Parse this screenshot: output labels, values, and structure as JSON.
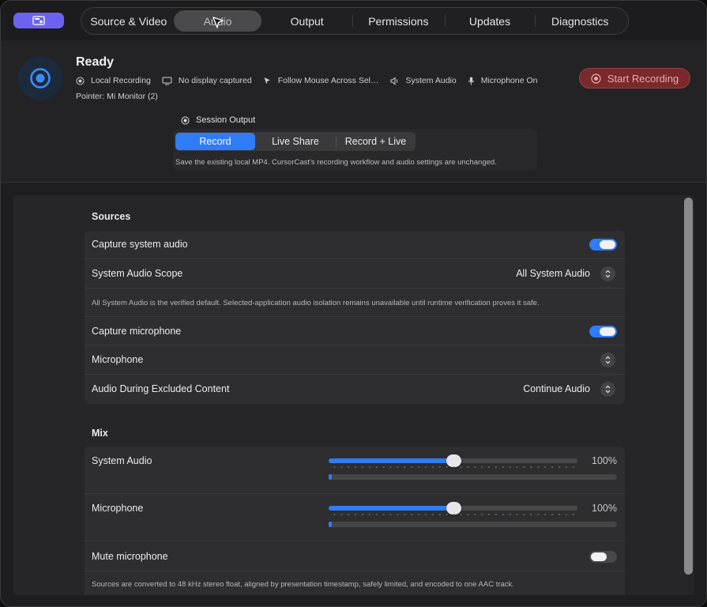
{
  "tabs": [
    {
      "label": "Source & Video"
    },
    {
      "label": "Audio"
    },
    {
      "label": "Output"
    },
    {
      "label": "Permissions"
    },
    {
      "label": "Updates"
    },
    {
      "label": "Diagnostics"
    }
  ],
  "header": {
    "status": "Ready",
    "status_items": [
      {
        "label": "Local Recording",
        "icon": "record-dot-icon"
      },
      {
        "label": "No display captured",
        "icon": "display-icon"
      },
      {
        "label": "Follow Mouse Across Sel…",
        "icon": "pointer-icon"
      },
      {
        "label": "System Audio",
        "icon": "speaker-icon"
      },
      {
        "label": "Microphone On",
        "icon": "microphone-icon"
      }
    ],
    "pointer": "Pointer: Mi Monitor (2)",
    "start_button": "Start Recording"
  },
  "session": {
    "label": "Session Output",
    "options": [
      "Record",
      "Live Share",
      "Record + Live"
    ],
    "selected": "Record",
    "description": "Save the existing local MP4. CursorCast's recording workflow and audio settings are unchanged."
  },
  "sources": {
    "title": "Sources",
    "capture_system_audio": {
      "label": "Capture system audio",
      "on": true
    },
    "system_audio_scope": {
      "label": "System Audio Scope",
      "value": "All System Audio"
    },
    "scope_note": "All System Audio is the verified default. Selected-application audio isolation remains unavailable until runtime verification proves it safe.",
    "capture_microphone": {
      "label": "Capture microphone",
      "on": true
    },
    "microphone": {
      "label": "Microphone",
      "value": ""
    },
    "excluded_content": {
      "label": "Audio During Excluded Content",
      "value": "Continue Audio"
    }
  },
  "mix": {
    "title": "Mix",
    "system_audio": {
      "label": "System Audio",
      "level": 0.5,
      "percent": "100%",
      "meter": 0.01
    },
    "microphone": {
      "label": "Microphone",
      "level": 0.5,
      "percent": "100%",
      "meter": 0.01
    },
    "mute_microphone": {
      "label": "Mute microphone",
      "on": false
    },
    "note": "Sources are converted to 48 kHz stereo float, aligned by presentation timestamp, safely limited, and encoded to one AAC track."
  },
  "colors": {
    "accent": "#2f7cf6",
    "app_button": "#6b63f0",
    "record_button": "#7a2a2c"
  }
}
